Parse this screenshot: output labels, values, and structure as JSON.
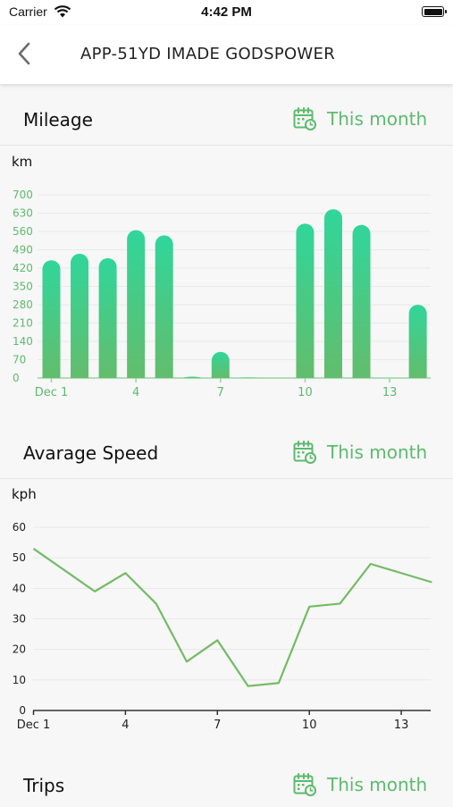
{
  "status_bar": {
    "carrier": "Carrier",
    "time": "4:42 PM"
  },
  "header": {
    "title": "APP-51YD IMADE GODSPOWER"
  },
  "sections": {
    "mileage": {
      "label": "Mileage",
      "period": "This month",
      "unit": "km"
    },
    "speed": {
      "label": "Avarage Speed",
      "period": "This month",
      "unit": "kph"
    },
    "trips": {
      "label": "Trips",
      "period": "This month"
    }
  },
  "colors": {
    "accent": "#5dba6d",
    "bar_top": "#30d69b",
    "bar_bottom": "#63bd6c",
    "line": "#74bb65"
  },
  "chart_data": [
    {
      "type": "bar",
      "ylabel": "km",
      "x": [
        1,
        2,
        3,
        4,
        5,
        6,
        7,
        8,
        9,
        10,
        11,
        12,
        13,
        14
      ],
      "x_ticks": [
        1,
        4,
        7,
        10,
        13
      ],
      "x_tick_labels": [
        "Dec 1",
        "4",
        "7",
        "10",
        "13"
      ],
      "values": [
        450,
        475,
        458,
        565,
        545,
        5,
        100,
        2,
        0,
        590,
        645,
        585,
        0,
        280
      ],
      "ylim": [
        0,
        700
      ],
      "y_ticks": [
        0,
        70,
        140,
        210,
        280,
        350,
        420,
        490,
        560,
        630,
        700
      ],
      "grid": true
    },
    {
      "type": "line",
      "ylabel": "kph",
      "x": [
        1,
        2,
        3,
        4,
        5,
        6,
        7,
        8,
        9,
        10,
        11,
        12,
        13,
        14
      ],
      "x_ticks": [
        1,
        4,
        7,
        10,
        13
      ],
      "x_tick_labels": [
        "Dec 1",
        "4",
        "7",
        "10",
        "13"
      ],
      "values": [
        53,
        46,
        39,
        45,
        35,
        16,
        23,
        8,
        9,
        34,
        35,
        48,
        45,
        42
      ],
      "ylim": [
        0,
        60
      ],
      "y_ticks": [
        0,
        10,
        20,
        30,
        40,
        50,
        60
      ],
      "grid": true
    }
  ]
}
